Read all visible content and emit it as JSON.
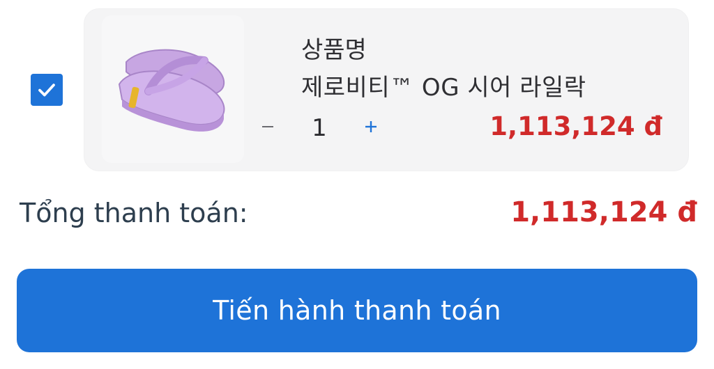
{
  "cart": {
    "item": {
      "selected": true,
      "name_line1": "상품명",
      "name_line2": "제로비티™ OG 시어 라일락",
      "quantity": "1",
      "price": "1,113,124 đ",
      "minus_icon": "minus-icon",
      "plus_icon": "plus-icon",
      "checkbox_icon": "checkmark-icon",
      "product_color": "#c9a6e3"
    },
    "total": {
      "label": "Tổng thanh toán:",
      "value": "1,113,124 đ"
    },
    "checkout": {
      "label": "Tiến hành thanh toán"
    }
  },
  "colors": {
    "accent": "#1e73d8",
    "price": "#d02a2a",
    "card_bg": "#f4f4f5",
    "text": "#2f2f33"
  }
}
